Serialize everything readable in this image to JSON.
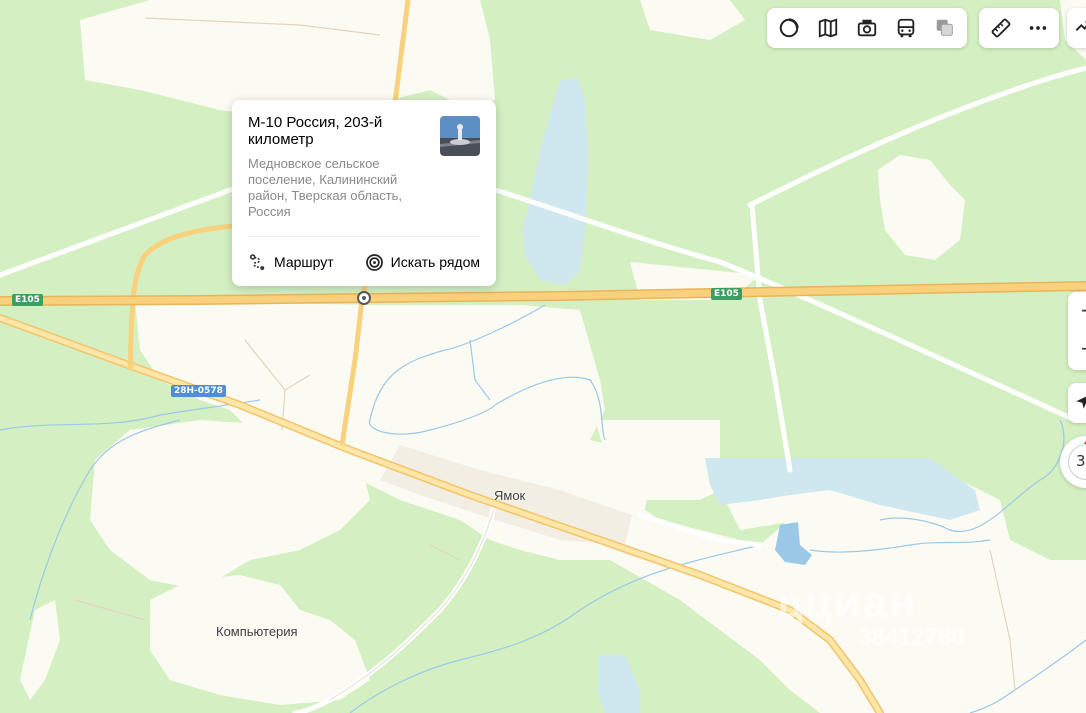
{
  "map": {
    "roads": {
      "e105_left": "E105",
      "e105_right": "E105",
      "regional": "28Н-0578"
    },
    "places": {
      "village": "Ямок",
      "district": "Компьютерия"
    },
    "watermark": {
      "brand": "циан",
      "number": "38412780"
    },
    "colors": {
      "forest": "#d4f0c3",
      "open_land": "#fcfbf3",
      "highway": "#f9d07c",
      "water": "#cfe7ee",
      "waterway": "#9cc8e8"
    }
  },
  "toolbar": {
    "buttons": [
      {
        "name": "layers",
        "icon": "circle-layers-icon"
      },
      {
        "name": "map-type",
        "icon": "map-book-icon"
      },
      {
        "name": "panorama",
        "icon": "camera-icon"
      },
      {
        "name": "transport",
        "icon": "bus-icon"
      },
      {
        "name": "overlay",
        "icon": "squares-icon"
      }
    ],
    "tools": [
      {
        "name": "ruler",
        "icon": "ruler-icon"
      },
      {
        "name": "more",
        "icon": "more-dots-icon"
      }
    ]
  },
  "card": {
    "title": "М-10 Россия, 203-й километр",
    "address": "Медновское сельское поселение, Калининский район, Тверская область, Россия",
    "route_label": "Маршрут",
    "search_nearby_label": "Искать рядом"
  },
  "controls": {
    "zoom_in": "+",
    "zoom_out": "−",
    "compass_value": "3"
  }
}
